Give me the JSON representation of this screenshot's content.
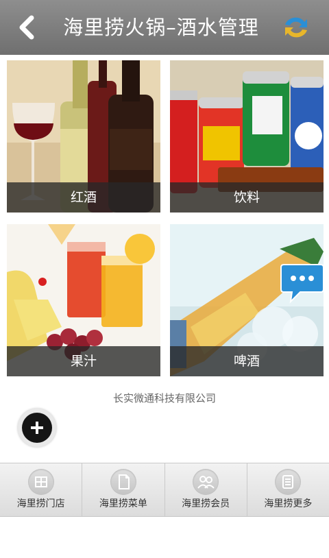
{
  "header": {
    "title": "海里捞火锅–酒水管理",
    "back_icon": "back-arrow-icon",
    "refresh_icon": "refresh-icon"
  },
  "categories": [
    {
      "label": "红酒"
    },
    {
      "label": "饮料"
    },
    {
      "label": "果汁"
    },
    {
      "label": "啤酒"
    }
  ],
  "footer": {
    "company": "长实微通科技有限公司"
  },
  "tabs": [
    {
      "label": "海里捞门店",
      "icon": "store-icon"
    },
    {
      "label": "海里捞菜单",
      "icon": "menu-document-icon"
    },
    {
      "label": "海里捞会员",
      "icon": "members-icon"
    },
    {
      "label": "海里捞更多",
      "icon": "more-list-icon"
    }
  ],
  "colors": {
    "header_bg": "#7f7f7f",
    "caption_bg": "#282828",
    "refresh_blue": "#2a8fd6",
    "refresh_yellow": "#e8b62a",
    "chat_blue": "#2a8fd6"
  }
}
